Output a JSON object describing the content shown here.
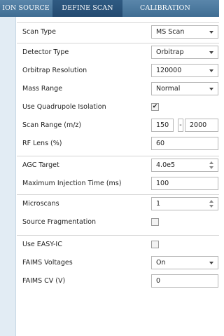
{
  "tabs": [
    {
      "label": "ION SOURCE",
      "active": false
    },
    {
      "label": "DEFINE SCAN",
      "active": true
    },
    {
      "label": "CALIBRATION",
      "active": false
    }
  ],
  "fields": {
    "scan_type": {
      "label": "Scan Type",
      "value": "MS Scan"
    },
    "detector_type": {
      "label": "Detector Type",
      "value": "Orbitrap"
    },
    "orbitrap_resolution": {
      "label": "Orbitrap Resolution",
      "value": "120000"
    },
    "mass_range": {
      "label": "Mass Range",
      "value": "Normal"
    },
    "use_quadrupole_isolation": {
      "label": "Use Quadrupole Isolation",
      "checked": true
    },
    "scan_range": {
      "label": "Scan Range (m/z)",
      "from": "150",
      "separator": "-",
      "to": "2000"
    },
    "rf_lens": {
      "label": "RF Lens (%)",
      "value": "60"
    },
    "agc_target": {
      "label": "AGC Target",
      "value": "4.0e5"
    },
    "max_injection_time": {
      "label": "Maximum Injection Time (ms)",
      "value": "100"
    },
    "microscans": {
      "label": "Microscans",
      "value": "1"
    },
    "source_fragmentation": {
      "label": "Source Fragmentation",
      "checked": false
    },
    "use_easy_ic": {
      "label": "Use EASY-IC",
      "checked": false
    },
    "faims_voltages": {
      "label": "FAIMS Voltages",
      "value": "On"
    },
    "faims_cv": {
      "label": "FAIMS CV (V)",
      "value": "0"
    }
  },
  "icons": {
    "dropdown": "chevron-down-icon",
    "spinner": "spinner-arrows-icon",
    "check": "checkmark-icon"
  }
}
